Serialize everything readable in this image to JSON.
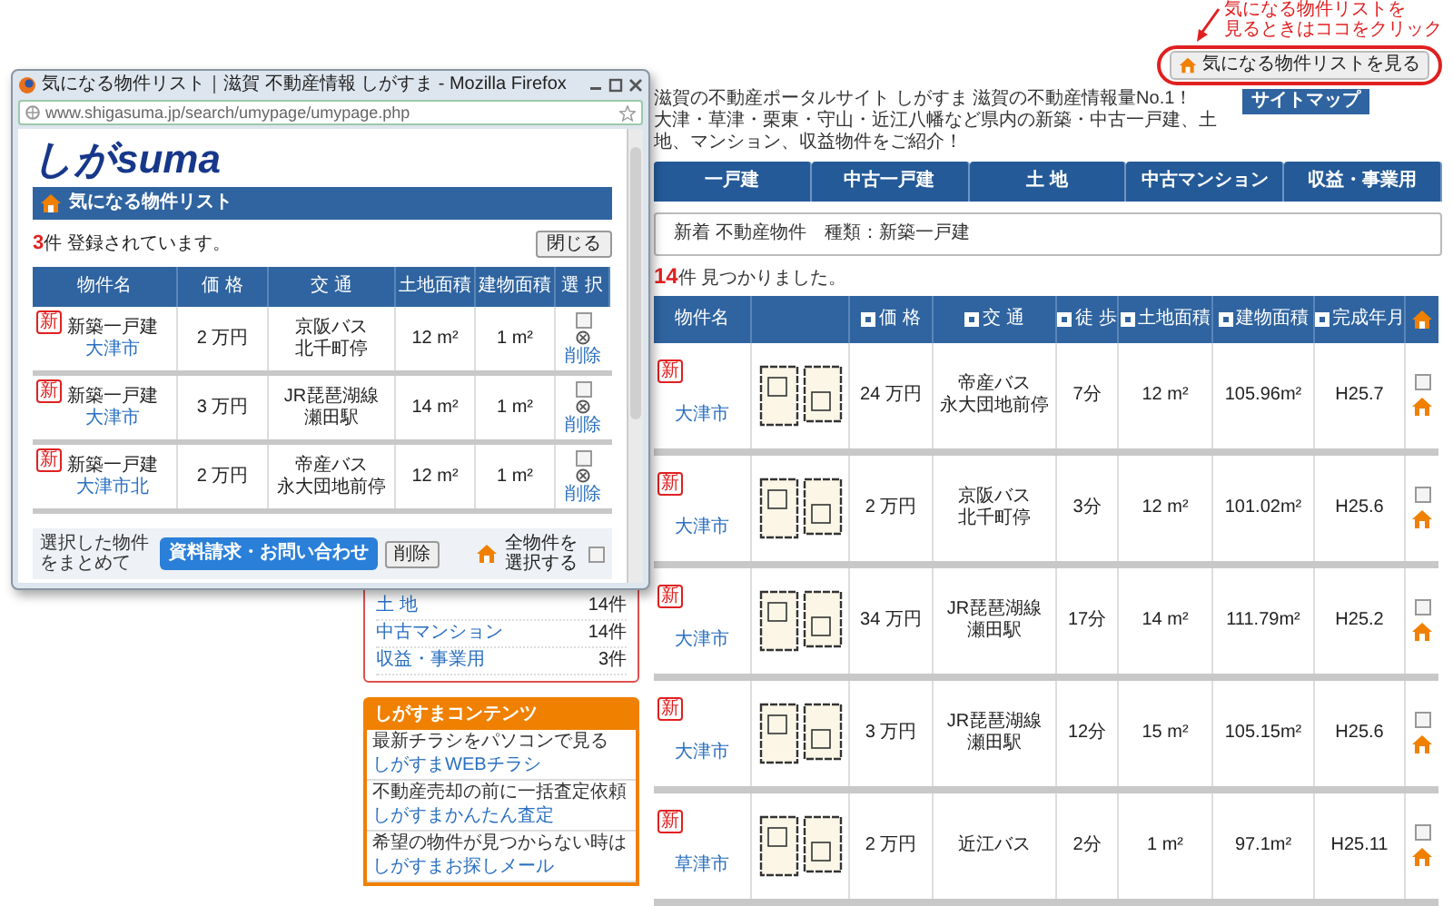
{
  "annotation": {
    "lines": [
      "気になる物件リストを",
      "見るときはココをクリック"
    ]
  },
  "favorites_button": {
    "label": "気になる物件リストを見る"
  },
  "site_header": {
    "lines": [
      "滋賀の不動産ポータルサイト しがすま 滋賀の不動産情報量No.1！",
      "大津・草津・栗東・守山・近江八幡など県内の新築・中古一戸建、土地、マンション、収益物件をご紹介！"
    ],
    "sitemap_button": "サイトマップ"
  },
  "nav_tabs": [
    "一戸建",
    "中古一戸建",
    "土 地",
    "中古マンション",
    "収益・事業用"
  ],
  "search_condition": "新着 不動産物件　種類：新築一戸建",
  "results": {
    "count": "14",
    "count_text": "件 見つかりました。",
    "columns": [
      {
        "kind": "text",
        "label": "物件名",
        "sortable": false
      },
      {
        "kind": "image"
      },
      {
        "kind": "text",
        "label": "価 格",
        "sortable": true
      },
      {
        "kind": "text",
        "label": "交 通",
        "sortable": true
      },
      {
        "kind": "text",
        "label": "徒 歩",
        "sortable": true
      },
      {
        "kind": "text",
        "label": "土地面積",
        "sortable": true
      },
      {
        "kind": "text",
        "label": "建物面積",
        "sortable": true
      },
      {
        "kind": "text",
        "label": "完成年月",
        "sortable": true
      },
      {
        "kind": "favorite"
      }
    ],
    "rows": [
      {
        "badge": "新",
        "location": "大津市",
        "price": "24 万円",
        "transit": [
          "帝産バス",
          "永大団地前停"
        ],
        "walk": "7分",
        "land_area": "12 m²",
        "building_area": "105.96m²",
        "completed": "H25.7",
        "checked": false
      },
      {
        "badge": "新",
        "location": "大津市",
        "price": "2 万円",
        "transit": [
          "京阪バス",
          "北千町停"
        ],
        "walk": "3分",
        "land_area": "12 m²",
        "building_area": "101.02m²",
        "completed": "H25.6",
        "checked": false
      },
      {
        "badge": "新",
        "location": "大津市",
        "price": "34 万円",
        "transit": [
          "JR琵琶湖線",
          "瀬田駅"
        ],
        "walk": "17分",
        "land_area": "14 m²",
        "building_area": "111.79m²",
        "completed": "H25.2",
        "checked": false
      },
      {
        "badge": "新",
        "location": "大津市",
        "price": "3 万円",
        "transit": [
          "JR琵琶湖線",
          "瀬田駅"
        ],
        "walk": "12分",
        "land_area": "15 m²",
        "building_area": "105.15m²",
        "completed": "H25.6",
        "checked": false
      },
      {
        "badge": "新",
        "location": "草津市",
        "price": "2 万円",
        "transit": [
          "近江バス"
        ],
        "walk": "2分",
        "land_area": "1 m²",
        "building_area": "97.1m²",
        "completed": "H25.11",
        "checked": false
      }
    ]
  },
  "sidebar": {
    "categories": [
      {
        "label": "土 地",
        "count": "14件"
      },
      {
        "label": "中古マンション",
        "count": "14件"
      },
      {
        "label": "収益・事業用",
        "count": "3件"
      }
    ],
    "contents": {
      "title": "しがすまコンテンツ",
      "items": [
        {
          "note": "最新チラシをパソコンで見る",
          "link": "しがすまWEBチラシ"
        },
        {
          "note": "不動産売却の前に一括査定依頼",
          "link": "しがすまかんたん査定"
        },
        {
          "note": "希望の物件が見つからない時は",
          "link": "しがすまお探しメール"
        }
      ]
    }
  },
  "popup": {
    "title": "気になる物件リスト｜滋賀 不動産情報 しがすま - Mozilla Firefox",
    "url": "www.shigasuma.jp/search/umypage/umypage.php",
    "logo": "しがsuma",
    "heading": "気になる物件リスト",
    "count": "3",
    "count_text": "件 登録されています。",
    "close_button": "閉じる",
    "columns": [
      "物件名",
      "価 格",
      "交 通",
      "土地面積",
      "建物面積",
      "選 択"
    ],
    "rows": [
      {
        "badge": "新",
        "type": "新築一戸建",
        "location": "大津市",
        "price": "2 万円",
        "transit": [
          "京阪バス",
          "北千町停"
        ],
        "land_area": "12 m²",
        "building_area": "1 m²",
        "checked": false,
        "delete_label": "削除"
      },
      {
        "badge": "新",
        "type": "新築一戸建",
        "location": "大津市",
        "price": "3 万円",
        "transit": [
          "JR琵琶湖線",
          "瀬田駅"
        ],
        "land_area": "14 m²",
        "building_area": "1 m²",
        "checked": false,
        "delete_label": "削除"
      },
      {
        "badge": "新",
        "type": "新築一戸建",
        "location": "大津市北",
        "price": "2 万円",
        "transit": [
          "帝産バス",
          "永大団地前停"
        ],
        "land_area": "12 m²",
        "building_area": "1 m²",
        "checked": false,
        "delete_label": "削除"
      }
    ],
    "footer": {
      "note": "選択した物件をまとめて",
      "request_button": "資料請求・お問い合わせ",
      "delete_button": "削除",
      "select_all_label": "全物件を選択する",
      "select_all_checked": false
    }
  }
}
